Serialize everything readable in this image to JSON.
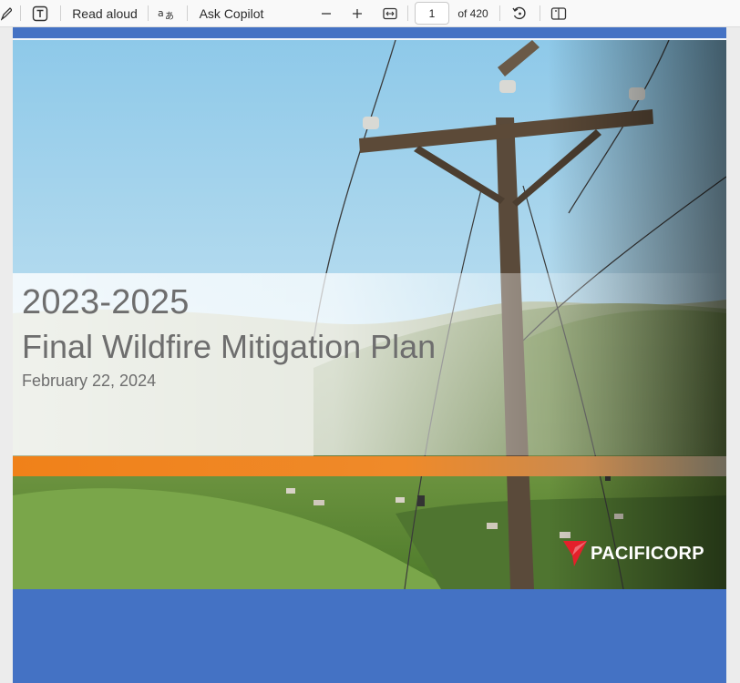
{
  "toolbar": {
    "read_aloud_label": "Read aloud",
    "ask_copilot_label": "Ask Copilot",
    "page_number": "1",
    "page_total": "of 420",
    "icons": [
      "draw-icon",
      "text-icon",
      "translate-icon",
      "zoom-out-icon",
      "zoom-in-icon",
      "fit-width-icon",
      "rotate-icon",
      "page-view-icon"
    ]
  },
  "document": {
    "title_years": "2023-2025",
    "title_main": "Final Wildfire Mitigation Plan",
    "date": "February 22, 2024",
    "logo_text": "PACIFICORP"
  },
  "colors": {
    "brand_blue": "#4472c4",
    "accent_orange": "#f08119",
    "logo_red": "#e4202a",
    "title_gray": "#6e6e6e"
  }
}
